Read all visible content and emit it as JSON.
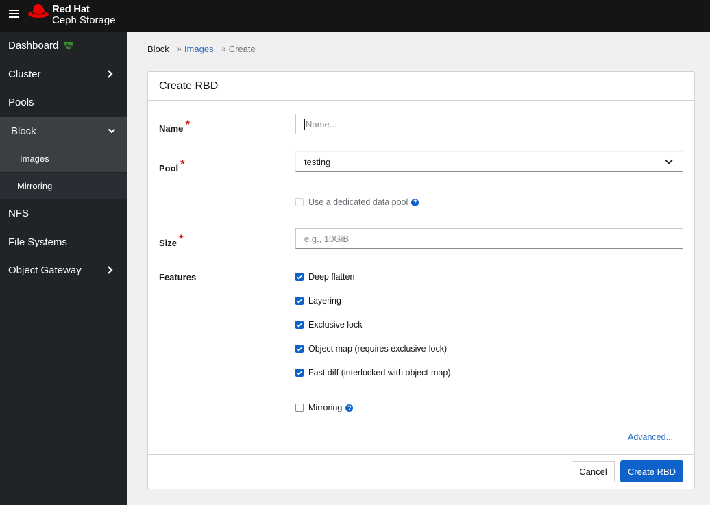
{
  "header": {
    "brand_line1": "Red Hat",
    "brand_line2": "Ceph Storage",
    "menu_icon": "hamburger-icon"
  },
  "sidebar": {
    "items": [
      {
        "label": "Dashboard",
        "icon": "heartbeat-icon",
        "status_color": "#3e8635"
      },
      {
        "label": "Cluster",
        "icon": "chevron-right-icon"
      },
      {
        "label": "Pools"
      },
      {
        "label": "Block",
        "icon": "chevron-down-icon",
        "expanded": true,
        "children": [
          {
            "label": "Images",
            "active": true
          },
          {
            "label": "Mirroring"
          }
        ]
      },
      {
        "label": "NFS"
      },
      {
        "label": "File Systems"
      },
      {
        "label": "Object Gateway",
        "icon": "chevron-right-icon"
      }
    ]
  },
  "breadcrumb": [
    "Block",
    "Images",
    "Create"
  ],
  "form": {
    "title": "Create RBD",
    "name": {
      "label": "Name",
      "value": "",
      "placeholder": "Name..."
    },
    "pool": {
      "label": "Pool",
      "value": "testing"
    },
    "data_pool": {
      "label": "Use a dedicated data pool",
      "checked": false,
      "disabled": true
    },
    "size": {
      "label": "Size",
      "value": "",
      "placeholder": "e.g., 10GiB"
    },
    "features": {
      "label": "Features",
      "options": [
        {
          "label": "Deep flatten",
          "checked": true
        },
        {
          "label": "Layering",
          "checked": true
        },
        {
          "label": "Exclusive lock",
          "checked": true
        },
        {
          "label": "Object map (requires exclusive-lock)",
          "checked": true
        },
        {
          "label": "Fast diff (interlocked with object-map)",
          "checked": true
        }
      ]
    },
    "mirroring": {
      "label": "Mirroring",
      "checked": false
    },
    "advanced_label": "Advanced...",
    "cancel_label": "Cancel",
    "submit_label": "Create RBD",
    "required_mark": "*",
    "help_mark": "?"
  },
  "colors": {
    "accent": "#0f62c9",
    "link": "#2b6fbf",
    "required": "#c9190b",
    "sidebar_bg": "#212427",
    "topbar_bg": "#151515"
  }
}
